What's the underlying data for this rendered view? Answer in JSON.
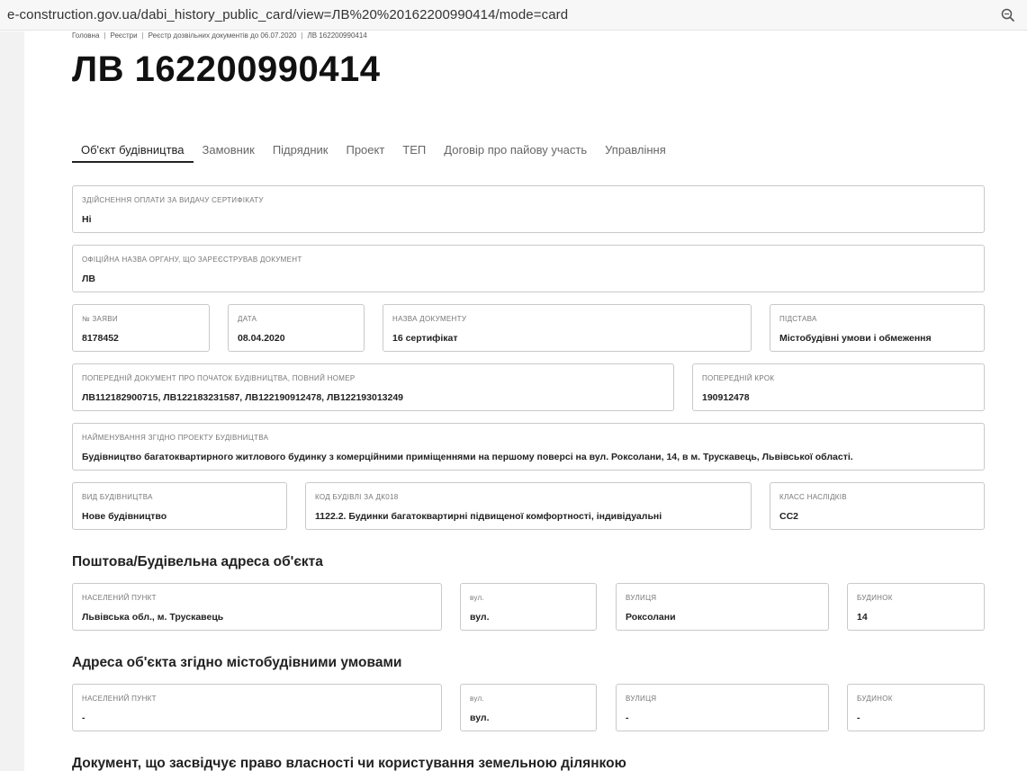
{
  "browser": {
    "url": "e-construction.gov.ua/dabi_history_public_card/view=ЛВ%20%20162200990414/mode=card",
    "zoom_icon": "zoom-icon"
  },
  "breadcrumb": [
    "Головна",
    "Реєстри",
    "Реєстр дозвільних документів до 06.07.2020",
    "ЛВ 162200990414"
  ],
  "title": "ЛВ 162200990414",
  "tabs": [
    "Об'єкт будівництва",
    "Замовник",
    "Підрядник",
    "Проект",
    "ТЕП",
    "Договір про пайову участь",
    "Управління"
  ],
  "fields": {
    "payment": {
      "label": "Здійснення оплати за видачу сертифікату",
      "value": "Ні"
    },
    "authority": {
      "label": "Офіційна назва органу, що зареєстрував документ",
      "value": "ЛВ"
    },
    "application_no": {
      "label": "№ заяви",
      "value": "8178452"
    },
    "date": {
      "label": "Дата",
      "value": "08.04.2020"
    },
    "doc_name": {
      "label": "Назва документу",
      "value": "16 сертифікат"
    },
    "basis": {
      "label": "Підстава",
      "value": "Містобудівні умови і обмеження"
    },
    "prev_doc": {
      "label": "Попередній документ про початок будівництва, повний номер",
      "value": "ЛВ112182900715, ЛВ122183231587, ЛВ122190912478, ЛВ122193013249"
    },
    "prev_step": {
      "label": "Попередній крок",
      "value": "190912478"
    },
    "project_name": {
      "label": "Найменування згідно проекту будівництва",
      "value": "Будівництво багатоквартирного житлового будинку з комерційними приміщеннями на першому поверсі на вул. Роксолани, 14, в м. Трускавець, Львівської області."
    },
    "build_type": {
      "label": "Вид будівництва",
      "value": "Нове будівництво"
    },
    "dk018": {
      "label": "Код будівлі за ДК018",
      "value": "1122.2. Будинки багатоквартирні підвищеної комфортності, індивідуальні"
    },
    "consequence_class": {
      "label": "Класс наслідків",
      "value": "СС2"
    }
  },
  "sections": {
    "postal_address": {
      "title": "Поштова/Будівельна адреса об'єкта",
      "settlement": {
        "label": "Населений пункт",
        "value": "Львівська обл., м. Трускавець"
      },
      "street_type": {
        "label": "вул.",
        "value": "вул."
      },
      "street": {
        "label": "Вулиця",
        "value": "Роксолани"
      },
      "building": {
        "label": "Будинок",
        "value": "14"
      }
    },
    "urban_address": {
      "title": "Адреса об'єкта згідно містобудівними умовами",
      "settlement": {
        "label": "Населений пункт",
        "value": "-"
      },
      "street_type": {
        "label": "вул.",
        "value": "вул."
      },
      "street": {
        "label": "Вулиця",
        "value": "-"
      },
      "building": {
        "label": "Будинок",
        "value": "-"
      }
    },
    "land_doc": {
      "title": "Документ, що засвідчує право власності чи користування земельною ділянкою"
    }
  }
}
